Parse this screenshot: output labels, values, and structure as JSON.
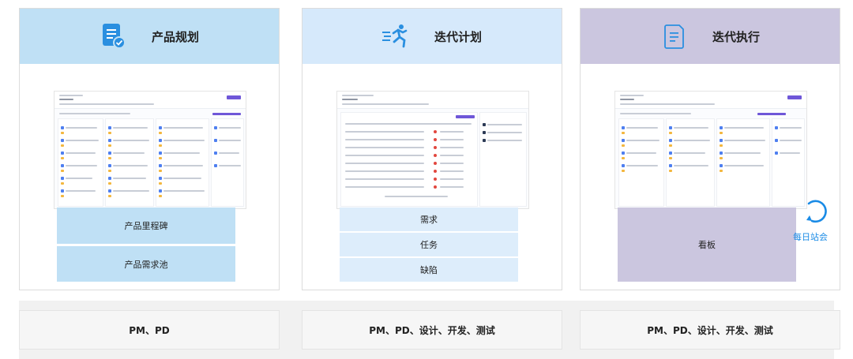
{
  "columns": [
    {
      "title": "产品规划",
      "icon": "document-check-icon",
      "header_color": "#bfe0f5",
      "items": [
        "产品里程碑",
        "产品需求池"
      ],
      "roles": "PM、PD"
    },
    {
      "title": "迭代计划",
      "icon": "runner-icon",
      "header_color": "#d6e9fb",
      "items": [
        "需求",
        "任务",
        "缺陷"
      ],
      "roles": "PM、PD、设计、开发、测试"
    },
    {
      "title": "迭代执行",
      "icon": "document-list-icon",
      "header_color": "#cbc6df",
      "items": [
        "看板"
      ],
      "roles": "PM、PD、设计、开发、测试",
      "loop_label": "每日站会"
    }
  ],
  "colors": {
    "accent_blue": "#1a8be6",
    "button_blue": "#bfe0f5",
    "button_light": "#ddedfb",
    "kanban_purple": "#cbc6df"
  }
}
